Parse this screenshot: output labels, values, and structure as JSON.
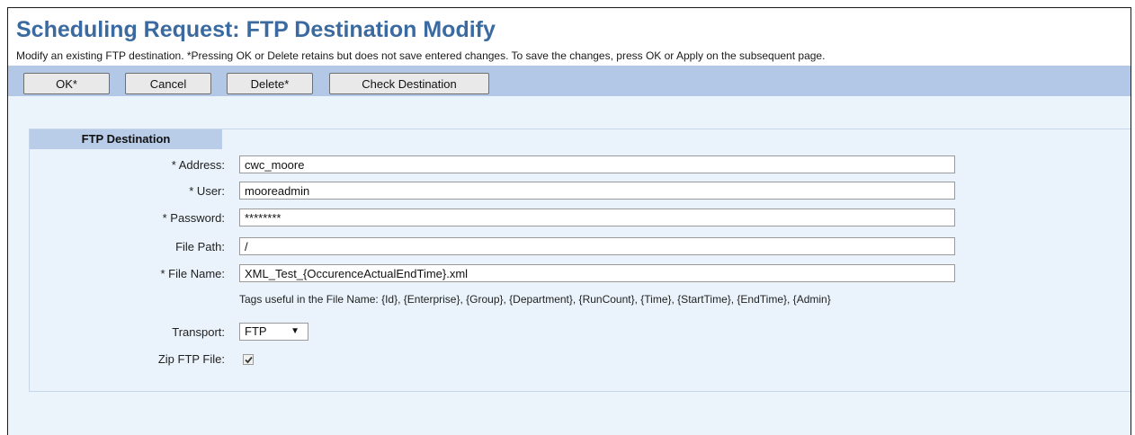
{
  "page": {
    "title": "Scheduling Request: FTP Destination Modify",
    "description": "Modify an existing FTP destination. *Pressing OK or Delete retains but does not save entered changes. To save the changes, press OK or Apply on the subsequent page."
  },
  "toolbar": {
    "ok_label": "OK*",
    "cancel_label": "Cancel",
    "delete_label": "Delete*",
    "check_label": "Check Destination"
  },
  "section": {
    "header": "FTP Destination"
  },
  "form": {
    "address": {
      "label": "* Address:",
      "value": "cwc_moore"
    },
    "user": {
      "label": "* User:",
      "value": "mooreadmin"
    },
    "password": {
      "label": "* Password:",
      "value": "********"
    },
    "file_path": {
      "label": "File Path:",
      "value": "/"
    },
    "file_name": {
      "label": "* File Name:",
      "value": "XML_Test_{OccurenceActualEndTime}.xml"
    },
    "tags_hint": "Tags useful in the File Name:  {Id}, {Enterprise}, {Group}, {Department}, {RunCount}, {Time}, {StartTime}, {EndTime}, {Admin}",
    "transport": {
      "label": "Transport:",
      "value": "FTP"
    },
    "zip": {
      "label": "Zip FTP File:",
      "checked": true
    }
  },
  "icons": {
    "dropdown": "chevron-down-icon",
    "checkbox_mark": "checkmark-icon"
  },
  "colors": {
    "title": "#3a6aa0",
    "toolbar_bg": "#b3c8e6",
    "content_bg": "#ecf4fb",
    "section_header_bg": "#b9cde8"
  }
}
